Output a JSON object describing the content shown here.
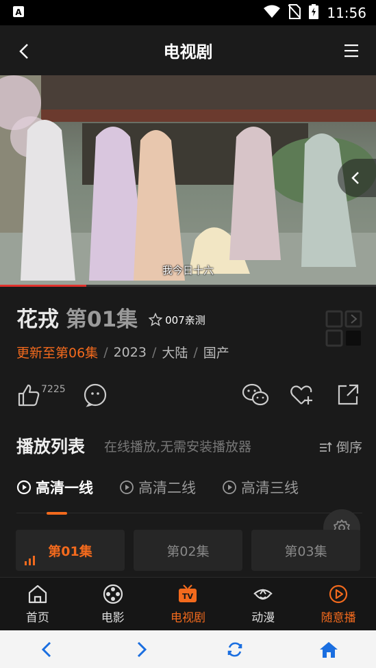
{
  "status_bar": {
    "time": "11:56"
  },
  "header": {
    "title": "电视剧"
  },
  "video": {
    "subtitle": "我今日十六",
    "progress": 0.23
  },
  "show": {
    "title": "花戎",
    "episode": "第01集",
    "rating_label": "007亲测",
    "update": "更新至第06集",
    "year": "2023",
    "region": "大陆",
    "origin": "国产",
    "sep": "/"
  },
  "actions": {
    "like_count": "7225"
  },
  "playlist": {
    "title": "播放列表",
    "marquee": "在线播放,无需安装播放器",
    "sort_label": "倒序"
  },
  "lines": [
    {
      "label": "高清一线"
    },
    {
      "label": "高清二线"
    },
    {
      "label": "高清三线"
    }
  ],
  "episodes": [
    {
      "label": "第01集"
    },
    {
      "label": "第02集"
    },
    {
      "label": "第03集"
    }
  ],
  "nav": [
    {
      "label": "首页",
      "icon": "home-icon"
    },
    {
      "label": "电影",
      "icon": "film-reel-icon"
    },
    {
      "label": "电视剧",
      "icon": "tv-icon"
    },
    {
      "label": "动漫",
      "icon": "anime-icon"
    },
    {
      "label": "随意播",
      "icon": "play-circle-icon"
    }
  ],
  "colors": {
    "accent": "#f36a1d",
    "browser_blue": "#1a6ee0"
  }
}
